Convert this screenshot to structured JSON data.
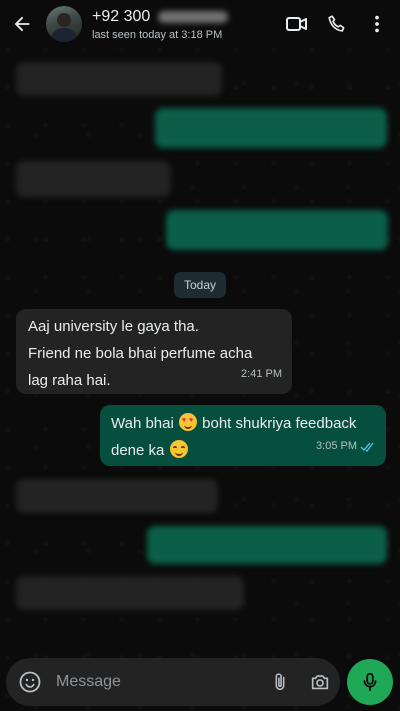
{
  "header": {
    "contact_name": "+92 300",
    "status": "last seen today at 3:18 PM"
  },
  "icons": {
    "back": "arrow-left-icon",
    "video": "video-call-icon",
    "call": "phone-icon",
    "menu": "more-vertical-icon",
    "emoji": "emoji-icon",
    "attach": "paperclip-icon",
    "camera": "camera-icon",
    "mic": "mic-icon"
  },
  "day_separator": "Today",
  "messages": [
    {
      "direction": "incoming",
      "lines": [
        "Aaj university le gaya tha.",
        "Friend ne bola bhai perfume acha",
        "lag raha hai."
      ],
      "time": "2:41 PM"
    },
    {
      "direction": "outgoing",
      "line1_a": "Wah bhai",
      "line1_b": "boht shukriya feedback",
      "line2": "dene ka",
      "time": "3:05 PM",
      "read": true
    }
  ],
  "composer": {
    "placeholder": "Message"
  },
  "colors": {
    "background": "#0b0b0b",
    "incoming_bubble": "#232323",
    "outgoing_bubble": "#064e3d",
    "accent": "#1fa855",
    "read_tick": "#53bdeb"
  }
}
